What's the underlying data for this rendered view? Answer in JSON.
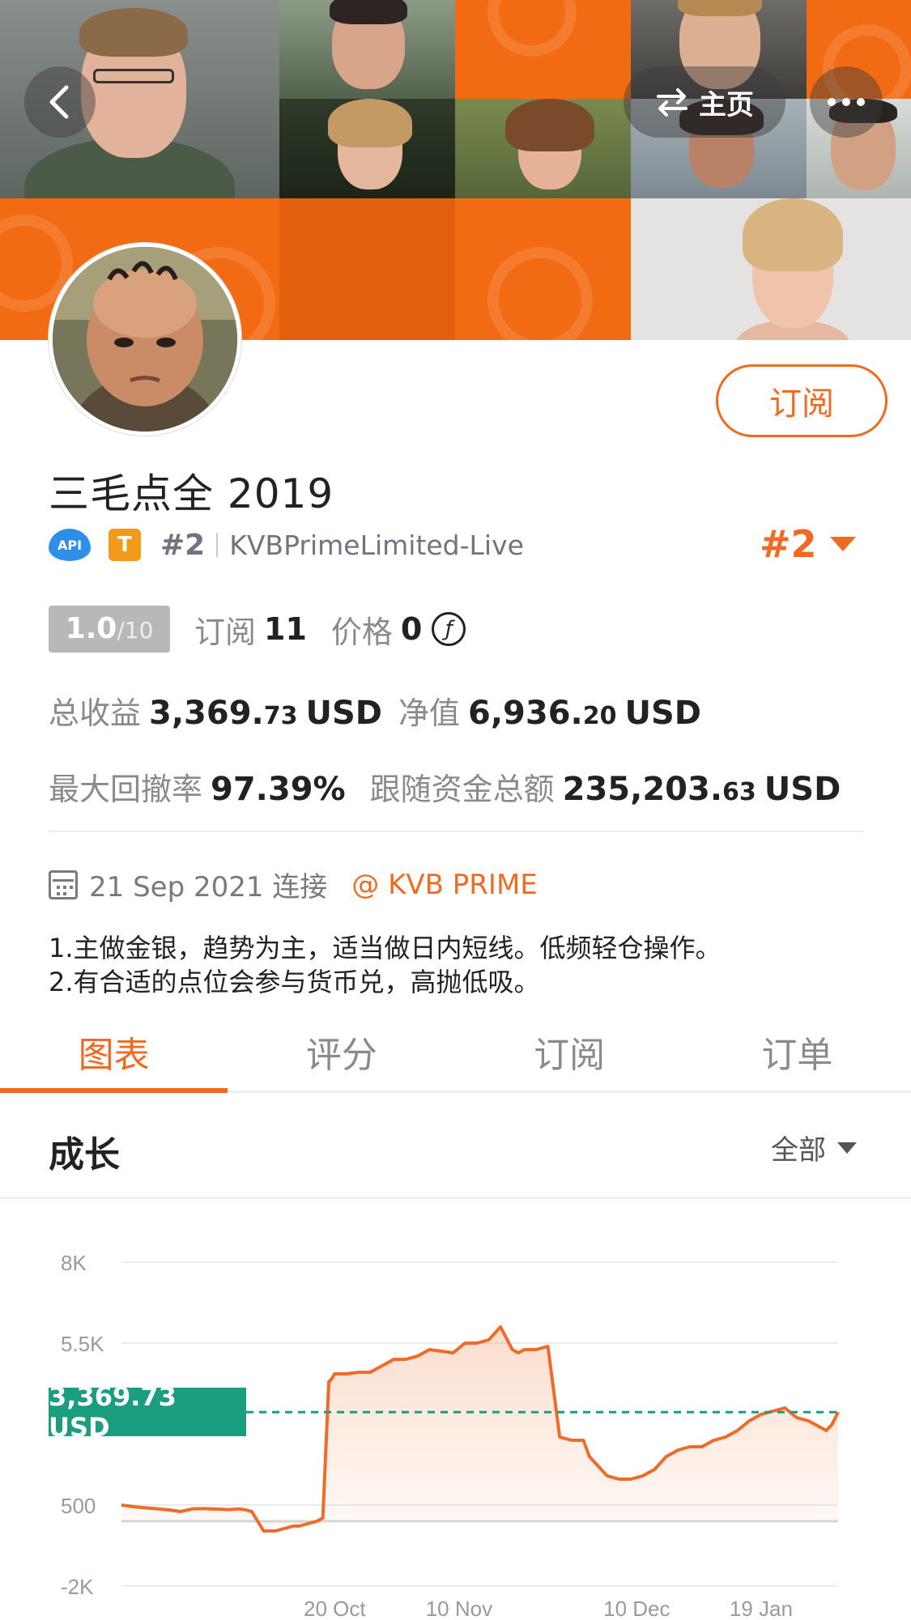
{
  "header": {
    "home_label": "主页",
    "back_icon": "chevron-left-icon",
    "more_icon": "more-dots-icon",
    "switch_icon": "swap-arrows-icon"
  },
  "profile": {
    "name": "三毛点全 2019",
    "subscribe_label": "订阅",
    "api_badge": "API",
    "tier_badge": "T",
    "rank_small": "#2",
    "broker": "KVBPrimeLimited-Live",
    "rank_big": "#2",
    "score_value": "1.0",
    "score_max": "/10",
    "subscribers_label": "订阅",
    "subscribers_value": "11",
    "price_label": "价格",
    "price_value": "0",
    "coin_symbol": "ƒ",
    "total_profit_label": "总收益",
    "total_profit_int": "3,369.",
    "total_profit_dec": "73",
    "total_profit_unit": "USD",
    "equity_label": "净值",
    "equity_int": "6,936.",
    "equity_dec": "20",
    "equity_unit": "USD",
    "max_drawdown_label": "最大回撤率",
    "max_drawdown_value": "97.39%",
    "follow_funds_label": "跟随资金总额",
    "follow_funds_int": "235,203.",
    "follow_funds_dec": "63",
    "follow_funds_unit": "USD",
    "connected_date": "21 Sep 2021 连接",
    "broker_link": "@ KVB PRIME",
    "description_line1": "1.主做金银，趋势为主，适当做日内短线。低频轻仓操作。",
    "description_line2": "2.有合适的点位会参与货币兑，高抛低吸。"
  },
  "tabs": [
    {
      "label": "图表",
      "active": true
    },
    {
      "label": "评分",
      "active": false
    },
    {
      "label": "订阅",
      "active": false
    },
    {
      "label": "订单",
      "active": false
    }
  ],
  "section": {
    "title": "成长",
    "filter_label": "全部"
  },
  "colors": {
    "accent": "#f26a22",
    "line_marker": "#1a9e7f"
  },
  "chart_data": {
    "type": "area",
    "ytick_labels": [
      "8K",
      "5.5K",
      "500",
      "-2K"
    ],
    "yticks": [
      8000,
      5500,
      500,
      -2000
    ],
    "ylim": [
      -2000,
      8000
    ],
    "xtick_labels": [
      "20 Oct",
      "10 Nov",
      "10 Dec",
      "19 Jan"
    ],
    "xticks": [
      36,
      57,
      87,
      108
    ],
    "xlim": [
      0,
      121
    ],
    "current_value": 3369.73,
    "current_label": "3,369.73 USD",
    "series": [
      {
        "x": [
          0,
          2,
          5,
          8,
          10,
          12,
          14,
          17,
          18,
          20,
          21,
          22,
          24,
          26,
          28,
          29,
          30,
          31,
          32,
          33,
          34,
          35,
          35.5,
          36,
          38,
          40,
          42,
          44,
          46,
          48,
          50,
          51,
          52,
          54,
          56,
          58,
          60,
          62,
          63,
          64,
          66,
          67,
          68,
          70,
          72,
          74,
          76,
          78,
          79,
          80,
          81,
          82,
          84,
          86,
          88,
          90,
          92,
          94,
          96,
          98,
          100,
          102,
          104,
          106,
          107,
          108,
          110,
          112,
          114,
          116,
          118,
          119,
          120,
          121
        ],
        "y": [
          500,
          450,
          400,
          350,
          300,
          380,
          390,
          370,
          360,
          380,
          350,
          300,
          -300,
          -300,
          -200,
          -150,
          -150,
          -100,
          -50,
          0,
          100,
          4300,
          4400,
          4550,
          4550,
          4600,
          4600,
          4800,
          5000,
          5000,
          5100,
          5200,
          5300,
          5250,
          5200,
          5500,
          5500,
          5600,
          5800,
          6000,
          5300,
          5200,
          5300,
          5300,
          5400,
          2600,
          2500,
          2500,
          2000,
          1800,
          1600,
          1400,
          1300,
          1300,
          1400,
          1600,
          2000,
          2200,
          2300,
          2300,
          2500,
          2600,
          2800,
          3100,
          3200,
          3300,
          3400,
          3500,
          3200,
          3100,
          2900,
          2800,
          3000,
          3369.73
        ]
      }
    ]
  }
}
